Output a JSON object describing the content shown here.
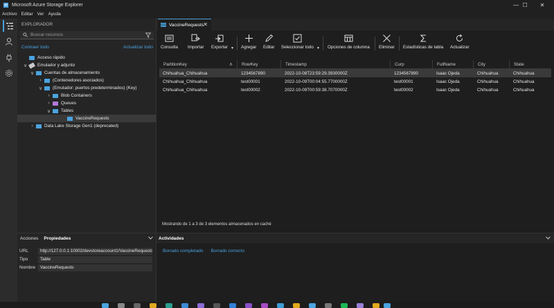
{
  "window": {
    "title": "Microsoft Azure Storage Explorer",
    "minimize": "—",
    "maximize": "☐",
    "close": "✕"
  },
  "menu": [
    "Archivo",
    "Editar",
    "Ver",
    "Ayuda"
  ],
  "explorer": {
    "header": "EXPLORADOR",
    "search_placeholder": "Buscar recursos",
    "collapse_all": "Contraer todo",
    "refresh_all": "Actualizar todo",
    "tree": [
      {
        "label": "Acceso rápido",
        "chevron": "",
        "icon_color": "#4aa3df"
      },
      {
        "label": "Emulador y adjunto",
        "chevron": "∨",
        "icon_color": "#c8c8c8"
      },
      {
        "label": "Cuentas de almacenamiento",
        "chevron": "∨",
        "icon_color": "#4aa3df"
      },
      {
        "label": "(Contenedores asociados)",
        "chevron": "›",
        "icon_color": "#4aa3df"
      },
      {
        "label": "(Emulador: puertos predeterminados) (Key)",
        "chevron": "∨",
        "icon_color": "#4aa3df"
      },
      {
        "label": "Blob Containers",
        "chevron": "›",
        "icon_color": "#4aa3df"
      },
      {
        "label": "Queues",
        "chevron": "›",
        "icon_color": "#b07ad6"
      },
      {
        "label": "Tables",
        "chevron": "∨",
        "icon_color": "#4aa3df"
      },
      {
        "label": "VaccineRequests",
        "chevron": "",
        "icon_color": "#4aa3df"
      },
      {
        "label": "Data Lake Storage Gen1 (deprecated)",
        "chevron": "›",
        "icon_color": "#4aa3df"
      }
    ]
  },
  "tab": {
    "label": "VaccineRequests",
    "close": "✕"
  },
  "toolbar": {
    "buttons": [
      {
        "label": "Consulta",
        "icon": "query-icon"
      },
      {
        "label": "Importar",
        "icon": "import-icon"
      },
      {
        "label": "Exportar",
        "icon": "export-icon"
      },
      {
        "label": "Agregar",
        "icon": "add-icon"
      },
      {
        "label": "Editar",
        "icon": "edit-icon"
      },
      {
        "label": "Seleccionar todo",
        "icon": "select-all-icon"
      },
      {
        "label": "Opciones de columna",
        "icon": "column-options-icon"
      },
      {
        "label": "Eliminar",
        "icon": "delete-icon"
      },
      {
        "label": "Estadísticas de tabla",
        "icon": "sigma-icon"
      },
      {
        "label": "Actualizar",
        "icon": "refresh-icon"
      }
    ]
  },
  "table": {
    "columns": [
      "PartitionKey",
      "RowKey",
      "Timestamp",
      "Curp",
      "FullName",
      "City",
      "State"
    ],
    "sort_indicator": "∧",
    "rows": [
      [
        "Chihuahua_Chihuahua",
        "1234567890",
        "2022-10-08T23:59:29.3930000Z",
        "1234567890",
        "Isaac Ojeda",
        "Chihuahua",
        "Chihuahua"
      ],
      [
        "Chihuahua_Chihuahua",
        "test00001",
        "2022-10-09T00:04:55.7700000Z",
        "test00001",
        "Isaac Ojeda",
        "Chihuahua",
        "Chihuahua"
      ],
      [
        "Chihuahua_Chihuahua",
        "test00002",
        "2022-10-09T00:59:38.7070000Z",
        "test00002",
        "Isaac Ojeda",
        "Chihuahua",
        "Chihuahua"
      ]
    ],
    "status": "Mostrando de 1 a 3 de 3 elementos almacenados en caché"
  },
  "properties": {
    "tabs": [
      "Acciones",
      "Propiedades"
    ],
    "rows": [
      {
        "key": "URL",
        "value": "http://127.0.0.1:10002/devstoreaccount1/VaccineRequests"
      },
      {
        "key": "Tipo",
        "value": "Table"
      },
      {
        "key": "Nombre",
        "value": "VaccineRequests"
      }
    ]
  },
  "activities": {
    "title": "Actividades",
    "links": [
      "Borrado completado",
      "Borrado correcto"
    ]
  },
  "colors": {
    "accent": "#4aa3df",
    "background": "#1e1e1e",
    "panel": "#252526",
    "selected_row": "#3a3a3a"
  }
}
